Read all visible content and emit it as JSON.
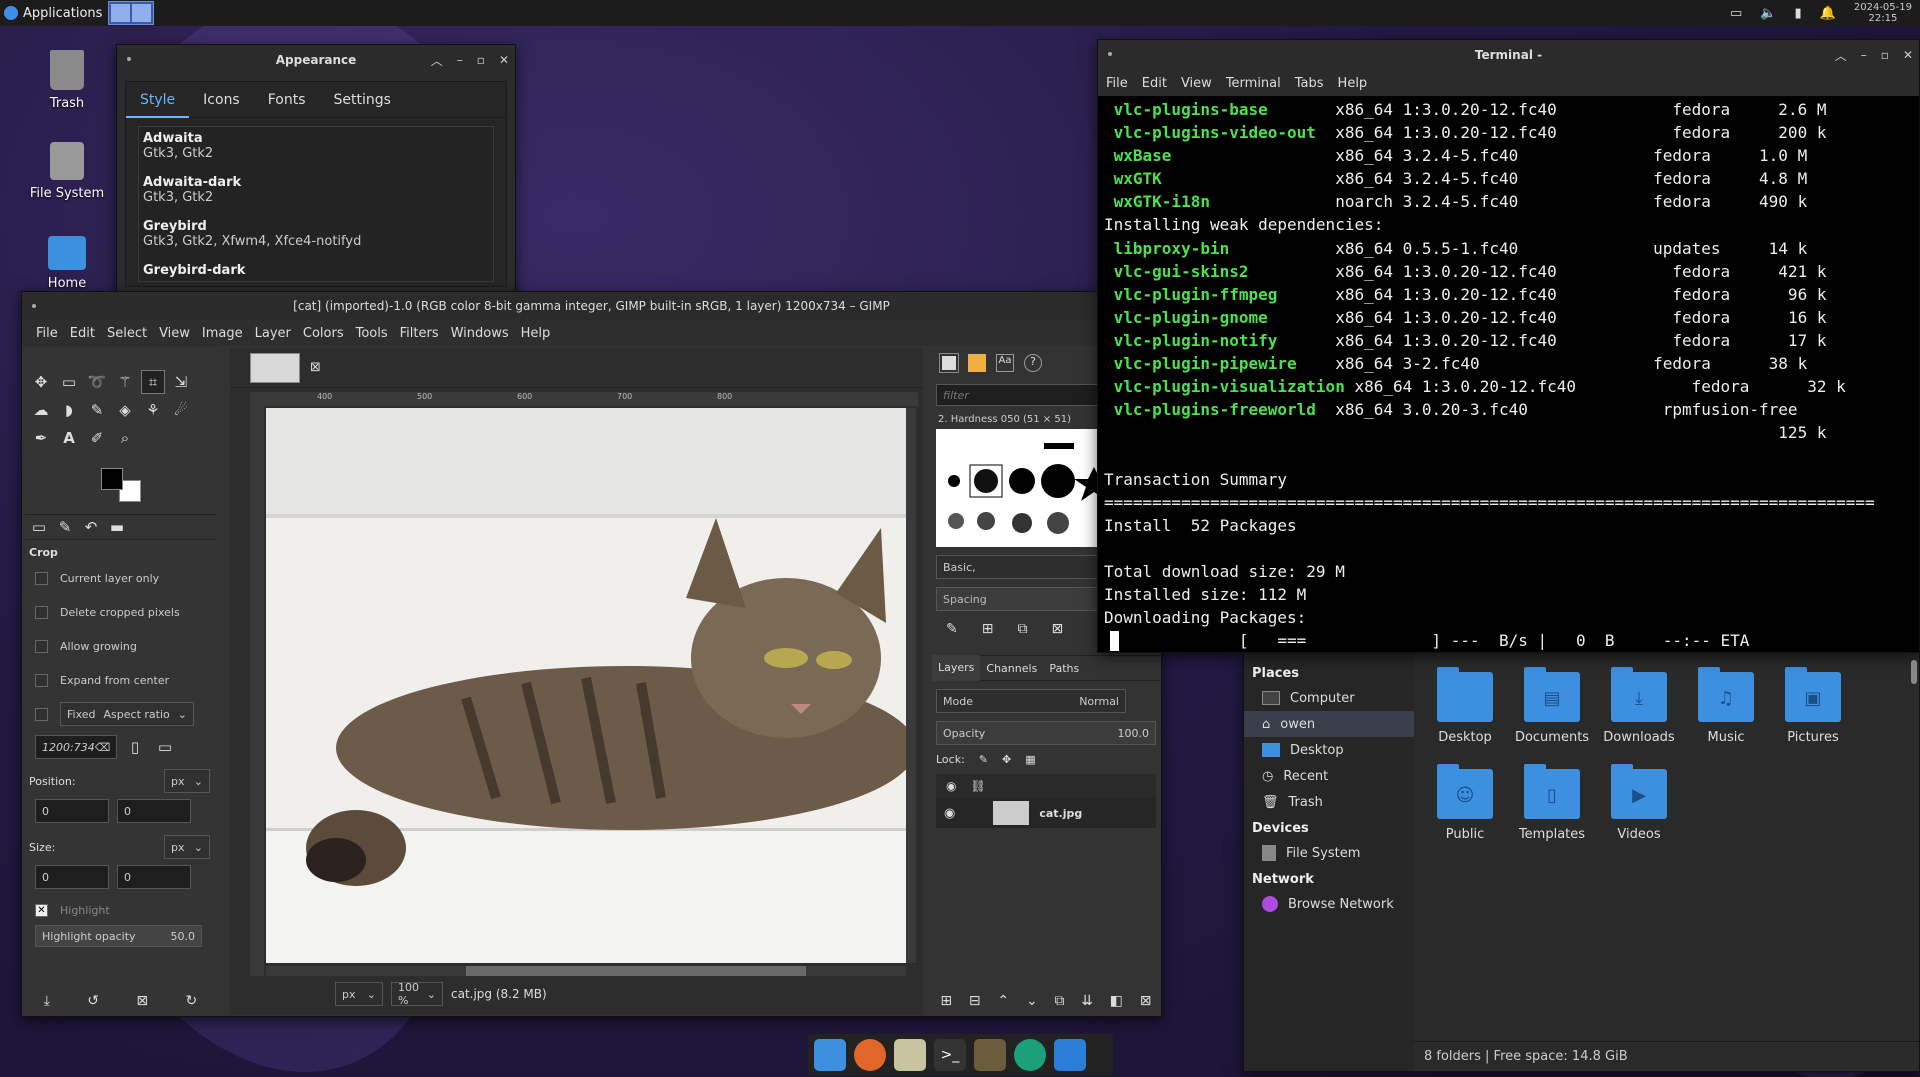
{
  "top_panel": {
    "applications_label": "Applications",
    "clock_date": "2024-05-19",
    "clock_time": "22:15"
  },
  "desktop_icons": [
    {
      "label": "Trash"
    },
    {
      "label": "File System"
    },
    {
      "label": "Home"
    }
  ],
  "appearance": {
    "title": "Appearance",
    "tabs": [
      "Style",
      "Icons",
      "Fonts",
      "Settings"
    ],
    "themes": [
      {
        "name": "Adwaita",
        "desc": "Gtk3, Gtk2"
      },
      {
        "name": "Adwaita-dark",
        "desc": "Gtk3, Gtk2"
      },
      {
        "name": "Greybird",
        "desc": "Gtk3, Gtk2, Xfwm4, Xfce4-notifyd"
      },
      {
        "name": "Greybird-dark",
        "desc": ""
      }
    ]
  },
  "gimp": {
    "title": "[cat] (imported)-1.0 (RGB color 8-bit gamma integer, GIMP built-in sRGB, 1 layer) 1200x734 – GIMP",
    "menu": [
      "File",
      "Edit",
      "Select",
      "View",
      "Image",
      "Layer",
      "Colors",
      "Tools",
      "Filters",
      "Windows",
      "Help"
    ],
    "ruler": [
      "400",
      "500",
      "600",
      "700",
      "800"
    ],
    "tool_options": {
      "heading": "Crop",
      "current_layer_only": "Current layer only",
      "delete_cropped": "Delete cropped pixels",
      "allow_growing": "Allow growing",
      "expand_center": "Expand from center",
      "fixed": "Fixed",
      "aspect": "Aspect ratio",
      "ratio_value": "1200:734",
      "position_label": "Position:",
      "size_label": "Size:",
      "unit": "px",
      "pos_x": "0",
      "pos_y": "0",
      "size_w": "0",
      "size_h": "0",
      "highlight": "Highlight",
      "highlight_opacity_label": "Highlight opacity",
      "highlight_opacity_value": "50.0"
    },
    "statusbar": {
      "unit": "px",
      "zoom": "100 %",
      "file": "cat.jpg (8.2 MB)"
    },
    "brushes": {
      "filter_placeholder": "filter",
      "brush_name": "2. Hardness 050 (51 × 51)",
      "preset": "Basic,",
      "spacing": "Spacing"
    },
    "layers": {
      "tabs": [
        "Layers",
        "Channels",
        "Paths"
      ],
      "mode_label": "Mode",
      "mode_value": "Normal",
      "opacity_label": "Opacity",
      "opacity_value": "100.0",
      "lock_label": "Lock:",
      "layer_name": "cat.jpg"
    }
  },
  "terminal": {
    "title": "Terminal -",
    "menu": [
      "File",
      "Edit",
      "View",
      "Terminal",
      "Tabs",
      "Help"
    ],
    "lines": [
      {
        "pkg": "vlc-plugins-base",
        "rest": "       x86_64 1:3.0.20-12.fc40            fedora     2.6 M"
      },
      {
        "pkg": "vlc-plugins-video-out",
        "rest": "  x86_64 1:3.0.20-12.fc40            fedora     200 k"
      },
      {
        "pkg": "wxBase",
        "rest": "                 x86_64 3.2.4-5.fc40              fedora     1.0 M"
      },
      {
        "pkg": "wxGTK",
        "rest": "                  x86_64 3.2.4-5.fc40              fedora     4.8 M"
      },
      {
        "pkg": "wxGTK-i18n",
        "rest": "             noarch 3.2.4-5.fc40              fedora     490 k"
      },
      {
        "pkg": "",
        "rest": "Installing weak dependencies:"
      },
      {
        "pkg": "libproxy-bin",
        "rest": "           x86_64 0.5.5-1.fc40              updates     14 k"
      },
      {
        "pkg": "vlc-gui-skins2",
        "rest": "         x86_64 1:3.0.20-12.fc40            fedora     421 k"
      },
      {
        "pkg": "vlc-plugin-ffmpeg",
        "rest": "      x86_64 1:3.0.20-12.fc40            fedora      96 k"
      },
      {
        "pkg": "vlc-plugin-gnome",
        "rest": "       x86_64 1:3.0.20-12.fc40            fedora      16 k"
      },
      {
        "pkg": "vlc-plugin-notify",
        "rest": "      x86_64 1:3.0.20-12.fc40            fedora      17 k"
      },
      {
        "pkg": "vlc-plugin-pipewire",
        "rest": "    x86_64 3-2.fc40                  fedora      38 k"
      },
      {
        "pkg": "vlc-plugin-visualization",
        "rest": " x86_64 1:3.0.20-12.fc40            fedora      32 k"
      },
      {
        "pkg": "vlc-plugins-freeworld",
        "rest": "  x86_64 3.0.20-3.fc40              rpmfusion-free"
      },
      {
        "pkg": "",
        "rest": "                                                                      125 k"
      },
      {
        "pkg": "",
        "rest": ""
      },
      {
        "pkg": "",
        "rest": "Transaction Summary"
      },
      {
        "pkg": "",
        "rest": "================================================================================"
      },
      {
        "pkg": "",
        "rest": "Install  52 Packages"
      },
      {
        "pkg": "",
        "rest": ""
      },
      {
        "pkg": "",
        "rest": "Total download size: 29 M"
      },
      {
        "pkg": "",
        "rest": "Installed size: 112 M"
      },
      {
        "pkg": "",
        "rest": "Downloading Packages:"
      },
      {
        "pkg": "",
        "rest": "              [   ===             ] ---  B/s |   0  B     --:-- ETA"
      }
    ]
  },
  "file_manager": {
    "places_heading": "Places",
    "places": [
      "Computer",
      "owen",
      "Desktop",
      "Recent",
      "Trash"
    ],
    "devices_heading": "Devices",
    "devices": [
      "File System"
    ],
    "network_heading": "Network",
    "network": [
      "Browse Network"
    ],
    "folders": [
      "Desktop",
      "Documents",
      "Downloads",
      "Music",
      "Pictures",
      "Public",
      "Templates",
      "Videos"
    ],
    "status": "8 folders  |  Free space: 14.8 GiB"
  }
}
